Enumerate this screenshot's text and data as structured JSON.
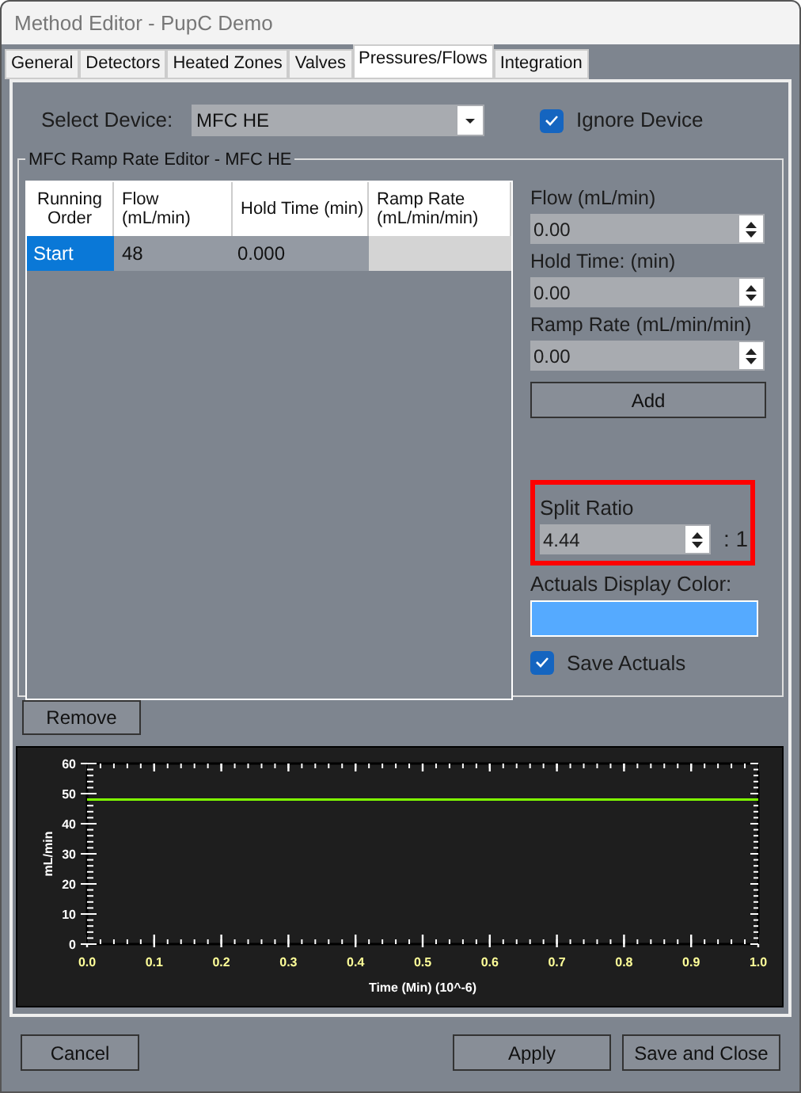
{
  "window": {
    "title": "Method Editor - PupC Demo"
  },
  "tabs": [
    {
      "label": "General",
      "selected": false
    },
    {
      "label": "Detectors",
      "selected": false
    },
    {
      "label": "Heated Zones",
      "selected": false
    },
    {
      "label": "Valves",
      "selected": false
    },
    {
      "label": "Pressures/Flows",
      "selected": true
    },
    {
      "label": "Integration",
      "selected": false
    }
  ],
  "device": {
    "label": "Select Device:",
    "value": "MFC HE",
    "ignore": {
      "label": "Ignore Device",
      "checked": true
    }
  },
  "ramp_editor": {
    "title": "MFC Ramp Rate Editor - MFC HE",
    "columns": [
      "Running Order",
      "Flow (mL/min)",
      "Hold Time (min)",
      "Ramp Rate (mL/min/min)"
    ],
    "rows": [
      {
        "running_order": "Start",
        "flow": "48",
        "hold_time": "0.000",
        "selected": true
      }
    ]
  },
  "fields": [
    {
      "label": "Flow (mL/min)",
      "value": "0.00"
    },
    {
      "label": "Hold Time: (min)",
      "value": "0.00"
    },
    {
      "label": "Ramp Rate (mL/min/min)",
      "value": "0.00"
    }
  ],
  "add_button": "Add",
  "split_ratio": {
    "label": "Split Ratio",
    "value": "4.44",
    "suffix": ": 1",
    "highlighted": true
  },
  "actuals_color": {
    "label": "Actuals Display Color:",
    "color": "#55aaff"
  },
  "save_actuals": {
    "label": "Save Actuals",
    "checked": true
  },
  "remove_button": "Remove",
  "chart": {
    "chart_data": {
      "type": "line",
      "xlabel": "Time (Min) (10^-6)",
      "ylabel": "mL/min",
      "x": [
        0,
        1
      ],
      "series": [
        {
          "color": "#7fff00",
          "values": [
            48,
            48
          ]
        }
      ],
      "xlim": [
        0,
        1
      ],
      "ylim": [
        0,
        60
      ],
      "xticks": [
        {
          "value": 0,
          "label": "0.0"
        },
        {
          "value": 0.1,
          "label": "0.1"
        },
        {
          "value": 0.2,
          "label": "0.2"
        },
        {
          "value": 0.3,
          "label": "0.3"
        },
        {
          "value": 0.4,
          "label": "0.4"
        },
        {
          "value": 0.5,
          "label": "0.5"
        },
        {
          "value": 0.6,
          "label": "0.6"
        },
        {
          "value": 0.7,
          "label": "0.7"
        },
        {
          "value": 0.8,
          "label": "0.8"
        },
        {
          "value": 0.9,
          "label": "0.9"
        },
        {
          "value": 1,
          "label": "1.0"
        }
      ],
      "yticks": [
        0,
        10,
        20,
        30,
        40,
        50,
        60
      ]
    }
  },
  "buttons": [
    {
      "label": "Cancel",
      "kind": "left"
    },
    {
      "label": "Apply",
      "kind": "right"
    },
    {
      "label": "Save and Close",
      "kind": "right"
    }
  ]
}
